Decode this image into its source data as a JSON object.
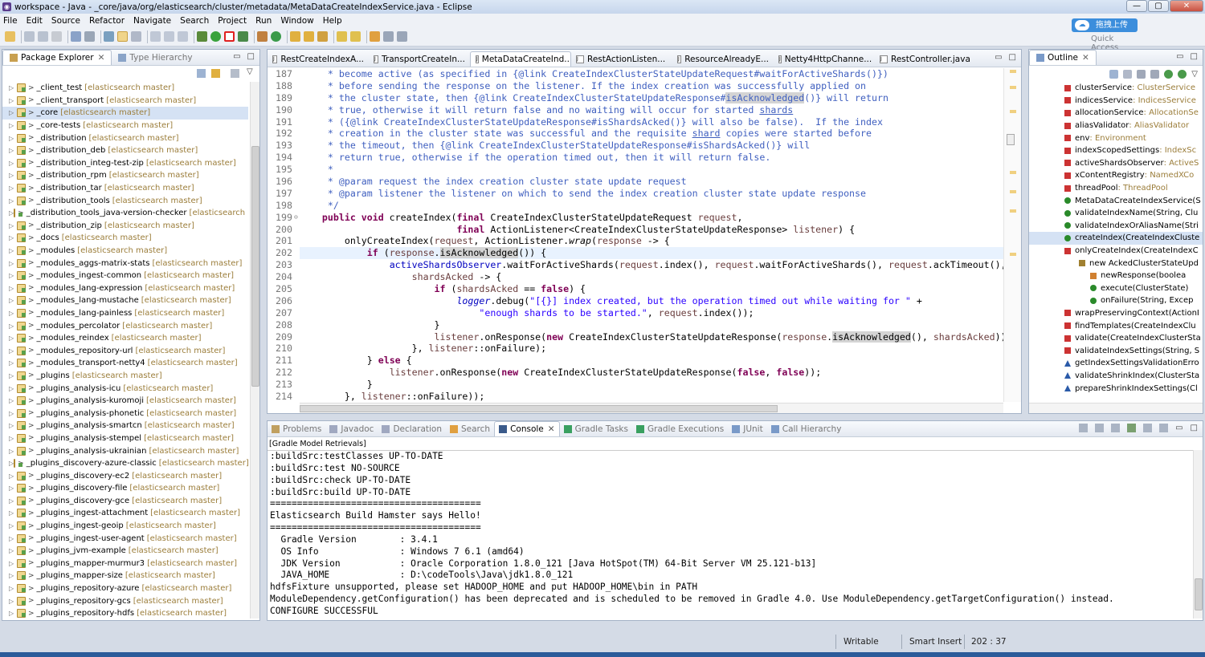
{
  "window": {
    "title": "workspace - Java - _core/java/org/elasticsearch/cluster/metadata/MetaDataCreateIndexService.java - Eclipse",
    "min": "—",
    "max": "▢",
    "close": "✕"
  },
  "menu": [
    "File",
    "Edit",
    "Source",
    "Refactor",
    "Navigate",
    "Search",
    "Project",
    "Run",
    "Window",
    "Help"
  ],
  "quick_access": {
    "cloud_label": "拖拽上传",
    "label": "Quick Access"
  },
  "package_explorer": {
    "tabs": [
      "Package Explorer",
      "Type Hierarchy"
    ],
    "items": [
      {
        "name": "_client_test",
        "repo": "[elasticsearch master]"
      },
      {
        "name": "_client_transport",
        "repo": "[elasticsearch master]"
      },
      {
        "name": "_core",
        "repo": "[elasticsearch master]",
        "selected": true
      },
      {
        "name": "_core-tests",
        "repo": "[elasticsearch master]"
      },
      {
        "name": "_distribution",
        "repo": "[elasticsearch master]"
      },
      {
        "name": "_distribution_deb",
        "repo": "[elasticsearch master]"
      },
      {
        "name": "_distribution_integ-test-zip",
        "repo": "[elasticsearch master]"
      },
      {
        "name": "_distribution_rpm",
        "repo": "[elasticsearch master]"
      },
      {
        "name": "_distribution_tar",
        "repo": "[elasticsearch master]"
      },
      {
        "name": "_distribution_tools",
        "repo": "[elasticsearch master]"
      },
      {
        "name": "_distribution_tools_java-version-checker",
        "repo": "[elasticsearch mas"
      },
      {
        "name": "_distribution_zip",
        "repo": "[elasticsearch master]"
      },
      {
        "name": "_docs",
        "repo": "[elasticsearch master]"
      },
      {
        "name": "_modules",
        "repo": "[elasticsearch master]"
      },
      {
        "name": "_modules_aggs-matrix-stats",
        "repo": "[elasticsearch master]"
      },
      {
        "name": "_modules_ingest-common",
        "repo": "[elasticsearch master]"
      },
      {
        "name": "_modules_lang-expression",
        "repo": "[elasticsearch master]"
      },
      {
        "name": "_modules_lang-mustache",
        "repo": "[elasticsearch master]"
      },
      {
        "name": "_modules_lang-painless",
        "repo": "[elasticsearch master]"
      },
      {
        "name": "_modules_percolator",
        "repo": "[elasticsearch master]"
      },
      {
        "name": "_modules_reindex",
        "repo": "[elasticsearch master]"
      },
      {
        "name": "_modules_repository-url",
        "repo": "[elasticsearch master]"
      },
      {
        "name": "_modules_transport-netty4",
        "repo": "[elasticsearch master]"
      },
      {
        "name": "_plugins",
        "repo": "[elasticsearch master]"
      },
      {
        "name": "_plugins_analysis-icu",
        "repo": "[elasticsearch master]"
      },
      {
        "name": "_plugins_analysis-kuromoji",
        "repo": "[elasticsearch master]"
      },
      {
        "name": "_plugins_analysis-phonetic",
        "repo": "[elasticsearch master]"
      },
      {
        "name": "_plugins_analysis-smartcn",
        "repo": "[elasticsearch master]"
      },
      {
        "name": "_plugins_analysis-stempel",
        "repo": "[elasticsearch master]"
      },
      {
        "name": "_plugins_analysis-ukrainian",
        "repo": "[elasticsearch master]"
      },
      {
        "name": "_plugins_discovery-azure-classic",
        "repo": "[elasticsearch master]"
      },
      {
        "name": "_plugins_discovery-ec2",
        "repo": "[elasticsearch master]"
      },
      {
        "name": "_plugins_discovery-file",
        "repo": "[elasticsearch master]"
      },
      {
        "name": "_plugins_discovery-gce",
        "repo": "[elasticsearch master]"
      },
      {
        "name": "_plugins_ingest-attachment",
        "repo": "[elasticsearch master]"
      },
      {
        "name": "_plugins_ingest-geoip",
        "repo": "[elasticsearch master]"
      },
      {
        "name": "_plugins_ingest-user-agent",
        "repo": "[elasticsearch master]"
      },
      {
        "name": "_plugins_jvm-example",
        "repo": "[elasticsearch master]"
      },
      {
        "name": "_plugins_mapper-murmur3",
        "repo": "[elasticsearch master]"
      },
      {
        "name": "_plugins_mapper-size",
        "repo": "[elasticsearch master]"
      },
      {
        "name": "_plugins_repository-azure",
        "repo": "[elasticsearch master]"
      },
      {
        "name": "_plugins_repository-gcs",
        "repo": "[elasticsearch master]"
      },
      {
        "name": "_plugins_repository-hdfs",
        "repo": "[elasticsearch master]"
      }
    ]
  },
  "editor": {
    "tabs": [
      "RestCreateIndexA...",
      "TransportCreateIn...",
      "MetaDataCreateInd...",
      "RestActionListen...",
      "ResourceAlreadyE...",
      "Netty4HttpChanne...",
      "RestController.java"
    ],
    "active_tab": 2,
    "line_numbers": [
      "187",
      "188",
      "189",
      "190",
      "191",
      "192",
      "193",
      "194",
      "195",
      "196",
      "197",
      "198",
      "199",
      "200",
      "201",
      "202",
      "203",
      "204",
      "205",
      "206",
      "207",
      "208",
      "209",
      "210",
      "211",
      "212",
      "213",
      "214"
    ]
  },
  "outline": {
    "tab": "Outline",
    "items": [
      {
        "name": "clusterService",
        "type": " : ClusterService",
        "color": "#c33"
      },
      {
        "name": "indicesService",
        "type": " : IndicesService",
        "color": "#c33"
      },
      {
        "name": "allocationService",
        "type": " : AllocationSe",
        "color": "#c33"
      },
      {
        "name": "aliasValidator",
        "type": " : AliasValidator",
        "color": "#c33"
      },
      {
        "name": "env",
        "type": " : Environment",
        "color": "#c33"
      },
      {
        "name": "indexScopedSettings",
        "type": " : IndexSc",
        "color": "#c33"
      },
      {
        "name": "activeShardsObserver",
        "type": " : ActiveS",
        "color": "#c33"
      },
      {
        "name": "xContentRegistry",
        "type": " : NamedXCo",
        "color": "#c33"
      },
      {
        "name": "threadPool",
        "type": " : ThreadPool",
        "color": "#c33"
      },
      {
        "name": "MetaDataCreateIndexService(S",
        "type": "",
        "color": "#2a8a2a"
      },
      {
        "name": "validateIndexName(String, Clu",
        "type": "",
        "color": "#2a8a2a"
      },
      {
        "name": "validateIndexOrAliasName(Stri",
        "type": "",
        "color": "#2a8a2a"
      },
      {
        "name": "createIndex(CreateIndexCluste",
        "type": "",
        "color": "#2a8a2a",
        "selected": true
      },
      {
        "name": "onlyCreateIndex(CreateIndexC",
        "type": "",
        "color": "#c33"
      },
      {
        "name": "new AckedClusterStateUpd",
        "type": "",
        "color": "#a08030"
      },
      {
        "name": "newResponse(boolea",
        "type": "",
        "color": "#d08030"
      },
      {
        "name": "execute(ClusterState)",
        "type": "",
        "color": "#2a8a2a"
      },
      {
        "name": "onFailure(String, Excep",
        "type": "",
        "color": "#2a8a2a"
      },
      {
        "name": "wrapPreservingContext(ActionI",
        "type": "",
        "color": "#c33"
      },
      {
        "name": "findTemplates(CreateIndexClu",
        "type": "",
        "color": "#c33"
      },
      {
        "name": "validate(CreateIndexClusterSta",
        "type": "",
        "color": "#c33"
      },
      {
        "name": "validateIndexSettings(String, S",
        "type": "",
        "color": "#c33"
      },
      {
        "name": "getIndexSettingsValidationErro",
        "type": "",
        "color": "#2a5aa8"
      },
      {
        "name": "validateShrinkIndex(ClusterSta",
        "type": "",
        "color": "#2a5aa8"
      },
      {
        "name": "prepareShrinkIndexSettings(Cl",
        "type": "",
        "color": "#2a5aa8"
      }
    ]
  },
  "console": {
    "tabs": [
      "Problems",
      "Javadoc",
      "Declaration",
      "Search",
      "Console",
      "Gradle Tasks",
      "Gradle Executions",
      "JUnit",
      "Call Hierarchy"
    ],
    "active_tab": 4,
    "subtitle": "[Gradle Model Retrievals]",
    "lines": [
      ":buildSrc:testClasses UP-TO-DATE",
      ":buildSrc:test NO-SOURCE",
      ":buildSrc:check UP-TO-DATE",
      ":buildSrc:build UP-TO-DATE",
      "=======================================",
      "Elasticsearch Build Hamster says Hello!",
      "=======================================",
      "  Gradle Version        : 3.4.1",
      "  OS Info               : Windows 7 6.1 (amd64)",
      "  JDK Version           : Oracle Corporation 1.8.0_121 [Java HotSpot(TM) 64-Bit Server VM 25.121-b13]",
      "  JAVA_HOME             : D:\\codeTools\\Java\\jdk1.8.0_121",
      "hdfsFixture unsupported, please set HADOOP_HOME and put HADOOP_HOME\\bin in PATH",
      "ModuleDependency.getConfiguration() has been deprecated and is scheduled to be removed in Gradle 4.0. Use ModuleDependency.getTargetConfiguration() instead.",
      "CONFIGURE SUCCESSFUL"
    ]
  },
  "status": {
    "writable": "Writable",
    "insert": "Smart Insert",
    "position": "202 : 37"
  }
}
